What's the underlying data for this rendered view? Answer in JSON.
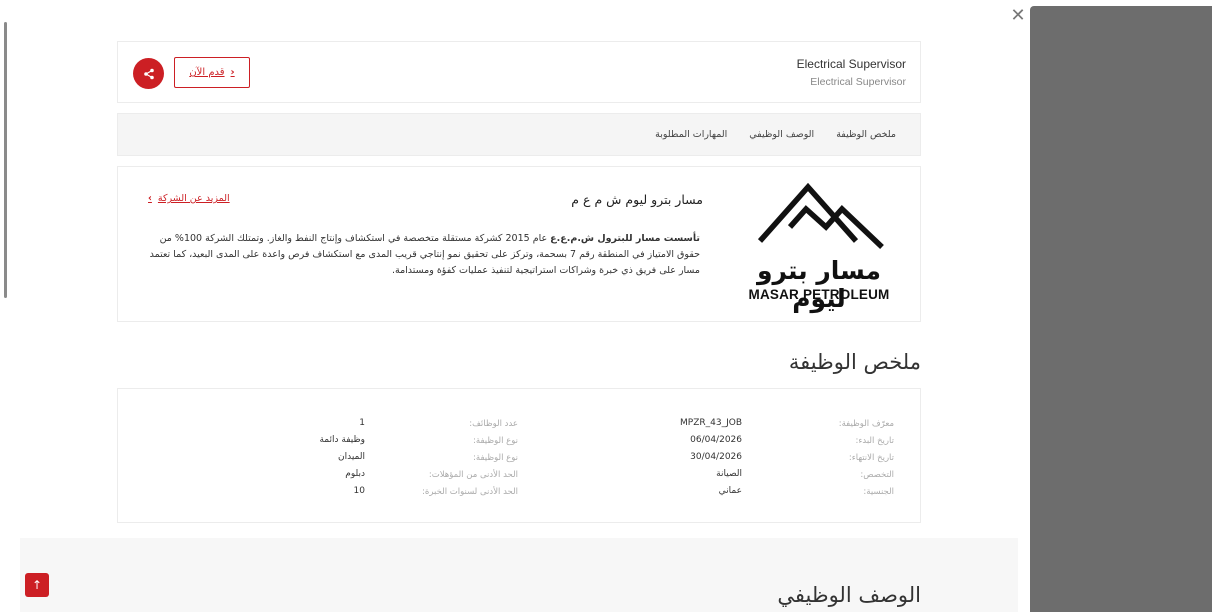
{
  "header": {
    "job_title": "Electrical Supervisor",
    "job_subtitle": "Electrical Supervisor",
    "apply_label": "قدم الآن"
  },
  "tabs": [
    {
      "label": "ملخص الوظيفة"
    },
    {
      "label": "الوصف الوظيفي"
    },
    {
      "label": "المهارات المطلوبة"
    }
  ],
  "company": {
    "name": "مسار بترو ليوم ش م ع م",
    "more_link": "المزيد عن الشركة",
    "desc_lead": "تأسست مسار للبترول ش.م.ع.ع",
    "desc_rest": " عام 2015 كشركة مستقلة متخصصة في استكشاف وإنتاج النفط والغاز. وتمتلك الشركة 100% من حقوق الامتياز في المنطقة رقم 7 بسحمة، وتركز على تحقيق نمو إنتاجي قريب المدى مع استكشاف فرص واعدة على المدى البعيد، كما تعتمد مسار على فريق ذي خبرة وشراكات استراتيجية لتنفيذ عمليات كفؤة ومستدامة.",
    "logo_ar": "مسار بترو ليوم",
    "logo_en": "MASAR PETROLEUM"
  },
  "summary": {
    "heading": "ملخص الوظيفة",
    "right_col": [
      {
        "label": "معرّف الوظيفة:",
        "value": "MPZR_43_JOB"
      },
      {
        "label": "تاريخ البدء:",
        "value": "06/04/2026"
      },
      {
        "label": "تاريخ الانتهاء:",
        "value": "30/04/2026"
      },
      {
        "label": "التخصص:",
        "value": "الصيانة"
      },
      {
        "label": "الجنسية:",
        "value": "عماني"
      }
    ],
    "left_col": [
      {
        "label": "عدد الوظائف:",
        "value": "1"
      },
      {
        "label": "نوع الوظيفة:",
        "value": "وظيفة دائمة"
      },
      {
        "label": "نوع الوظيفة:",
        "value": "الميدان"
      },
      {
        "label": "الحد الأدنى من المؤهلات:",
        "value": "دبلوم"
      },
      {
        "label": "الحد الأدنى لسنوات الخبرة:",
        "value": "10"
      }
    ]
  },
  "description": {
    "heading": "الوصف الوظيفي"
  },
  "icons": {
    "close": "close-icon",
    "share": "share-icon",
    "scroll_top": "arrow-up-icon"
  },
  "colors": {
    "accent": "#cc1f24",
    "panel": "#6d6d6d"
  }
}
